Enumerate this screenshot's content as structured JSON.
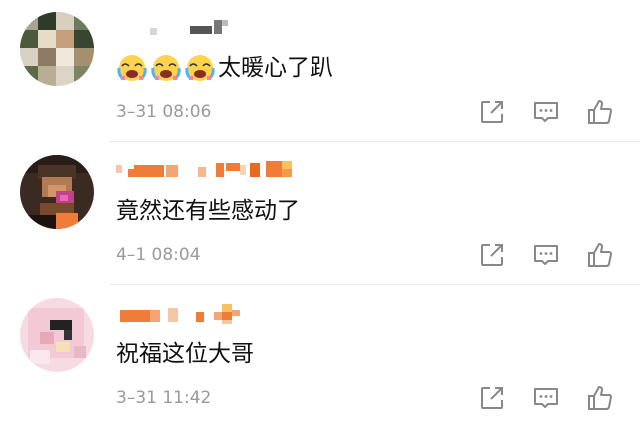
{
  "comments": [
    {
      "text": "太暖心了趴",
      "emoji_icons": [
        "crying-laughing-face-icon",
        "crying-laughing-face-icon",
        "crying-laughing-face-icon"
      ],
      "time": "3–31 08:06"
    },
    {
      "text": "竟然还有些感动了",
      "time": "4–1 08:04"
    },
    {
      "text": "祝福这位大哥",
      "time": "3–31 11:42"
    }
  ],
  "actions": {
    "share_icon": "share-icon",
    "reply_icon": "reply-icon",
    "like_icon": "thumbs-up-icon"
  },
  "colors": {
    "text": "#111111",
    "meta": "#9a9a9a",
    "icon": "#888888",
    "divider": "#e9e9e9",
    "orange": "#f07c3a"
  }
}
